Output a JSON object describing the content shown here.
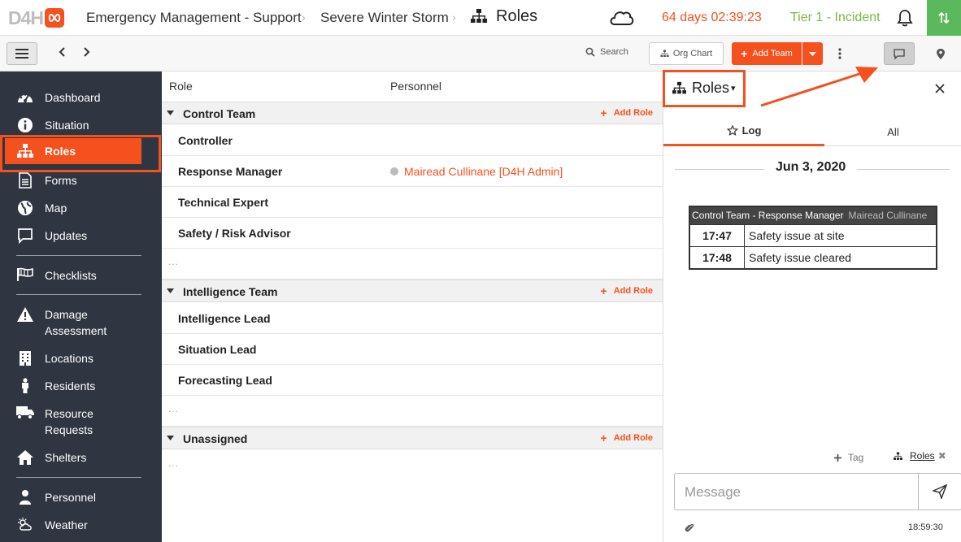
{
  "header": {
    "logo_text": "D4H",
    "breadcrumb_1": "Emergency Management - Support",
    "breadcrumb_2": "Severe Winter Storm",
    "page_title": "Roles",
    "weather_icon": "cloud-icon",
    "timer": "64 days 02:39:23",
    "tier": "Tier 1 - Incident",
    "colors": {
      "accent": "#f4511e",
      "tier": "#7ab648",
      "green_button": "#5cb85c",
      "sidebar": "#2f3541"
    }
  },
  "toolbar": {
    "search_label": "Search",
    "org_chart_label": "Org Chart",
    "add_team_label": "Add Team"
  },
  "sidebar": {
    "items": [
      {
        "label": "Dashboard",
        "icon": "dashboard-icon"
      },
      {
        "label": "Situation",
        "icon": "info-icon"
      },
      {
        "label": "Roles",
        "icon": "org-chart-icon",
        "active": true
      },
      {
        "label": "Forms",
        "icon": "forms-icon"
      },
      {
        "label": "Map",
        "icon": "globe-icon"
      },
      {
        "label": "Updates",
        "icon": "chat-icon"
      },
      {
        "label": "Checklists",
        "icon": "flags-icon"
      },
      {
        "label": "Damage Assessment",
        "icon": "warning-icon"
      },
      {
        "label": "Locations",
        "icon": "building-icon"
      },
      {
        "label": "Residents",
        "icon": "person-icon"
      },
      {
        "label": "Resource Requests",
        "icon": "truck-icon"
      },
      {
        "label": "Shelters",
        "icon": "home-icon"
      },
      {
        "label": "Personnel",
        "icon": "user-icon"
      },
      {
        "label": "Weather",
        "icon": "weather-icon"
      }
    ]
  },
  "roles_table": {
    "col_role": "Role",
    "col_personnel": "Personnel",
    "add_role_label": "Add Role",
    "ellipsis": "...",
    "teams": [
      {
        "name": "Control Team",
        "roles": [
          {
            "name": "Controller",
            "personnel": ""
          },
          {
            "name": "Response Manager",
            "personnel": "Mairead Cullinane [D4H Admin]"
          },
          {
            "name": "Technical Expert",
            "personnel": ""
          },
          {
            "name": "Safety / Risk Advisor",
            "personnel": ""
          }
        ]
      },
      {
        "name": "Intelligence Team",
        "roles": [
          {
            "name": "Intelligence Lead",
            "personnel": ""
          },
          {
            "name": "Situation Lead",
            "personnel": ""
          },
          {
            "name": "Forecasting Lead",
            "personnel": ""
          }
        ]
      },
      {
        "name": "Unassigned",
        "roles": []
      }
    ]
  },
  "panel": {
    "title": "Roles",
    "tab_log": "Log",
    "tab_all": "All",
    "date": "Jun 3, 2020",
    "log_card": {
      "header": "Control Team - Response Manager",
      "author": "Mairead Cullinane",
      "entries": [
        {
          "time": "17:47",
          "message": "Safety issue at site"
        },
        {
          "time": "17:48",
          "message": "Safety issue cleared"
        }
      ]
    },
    "tag_label": "Tag",
    "roles_tag": "Roles",
    "message_placeholder": "Message",
    "timestamp": "18:59:30"
  }
}
